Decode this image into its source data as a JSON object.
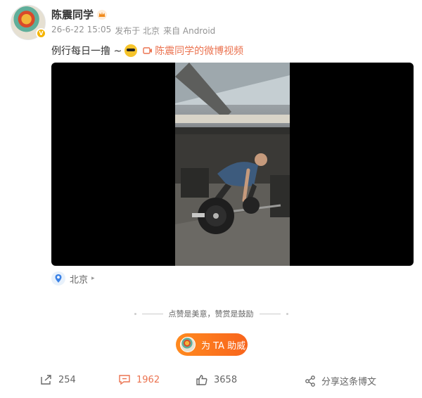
{
  "author": {
    "name": "陈震同学"
  },
  "meta": {
    "time": "26-6-22 15:05",
    "publish": "发布于 北京",
    "source": "来自 Android"
  },
  "post": {
    "text": "例行每日一撸 ~",
    "video_link": "陈震同学的微博视频"
  },
  "location": {
    "label": "北京"
  },
  "appreciate": {
    "text": "点赞是美意，赞赏是鼓励"
  },
  "support": {
    "label": "为 TA 助威"
  },
  "actions": {
    "forward": "254",
    "comment": "1962",
    "like": "3658",
    "share": "分享这条博文"
  },
  "colors": {
    "accent": "#eb7350",
    "support": "#f8641c"
  }
}
